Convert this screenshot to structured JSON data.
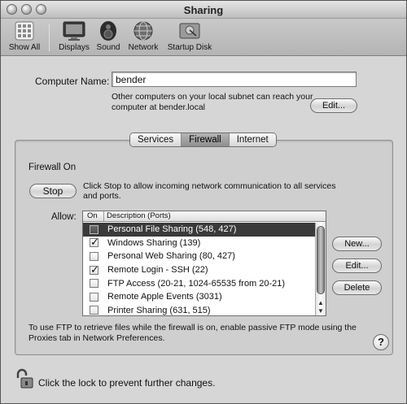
{
  "window": {
    "title": "Sharing"
  },
  "toolbar": {
    "items": [
      {
        "label": "Show All",
        "icon": "apple-grid-icon"
      },
      {
        "label": "Displays",
        "icon": "monitor-icon"
      },
      {
        "label": "Sound",
        "icon": "speaker-icon"
      },
      {
        "label": "Network",
        "icon": "globe-icon"
      },
      {
        "label": "Startup Disk",
        "icon": "hard-disk-icon"
      }
    ]
  },
  "computer_name": {
    "label": "Computer Name:",
    "value": "bender",
    "help": "Other computers on your local subnet can reach your computer at bender.local",
    "edit_label": "Edit..."
  },
  "tabs": [
    {
      "label": "Services",
      "active": false
    },
    {
      "label": "Firewall",
      "active": true
    },
    {
      "label": "Internet",
      "active": false
    }
  ],
  "firewall": {
    "status": "Firewall On",
    "stop_label": "Stop",
    "stop_help": "Click Stop to allow incoming network communication to all services and ports.",
    "allow_label": "Allow:",
    "columns": {
      "on": "On",
      "description": "Description (Ports)"
    },
    "services": [
      {
        "label": "Personal File Sharing (548, 427)",
        "checked": false,
        "selected": true
      },
      {
        "label": "Windows Sharing (139)",
        "checked": true,
        "selected": false
      },
      {
        "label": "Personal Web Sharing (80, 427)",
        "checked": false,
        "selected": false
      },
      {
        "label": "Remote Login - SSH (22)",
        "checked": true,
        "selected": false
      },
      {
        "label": "FTP Access (20-21, 1024-65535 from 20-21)",
        "checked": false,
        "selected": false
      },
      {
        "label": "Remote Apple Events (3031)",
        "checked": false,
        "selected": false
      },
      {
        "label": "Printer Sharing (631, 515)",
        "checked": false,
        "selected": false
      }
    ],
    "buttons": {
      "new": "New...",
      "edit": "Edit...",
      "delete": "Delete"
    },
    "ftp_note": "To use FTP to retrieve files while the firewall is on, enable passive FTP mode using the Proxies tab in Network Preferences.",
    "help_label": "?"
  },
  "lock": {
    "text": "Click the lock to prevent further changes.",
    "icon": "padlock-open-icon"
  }
}
